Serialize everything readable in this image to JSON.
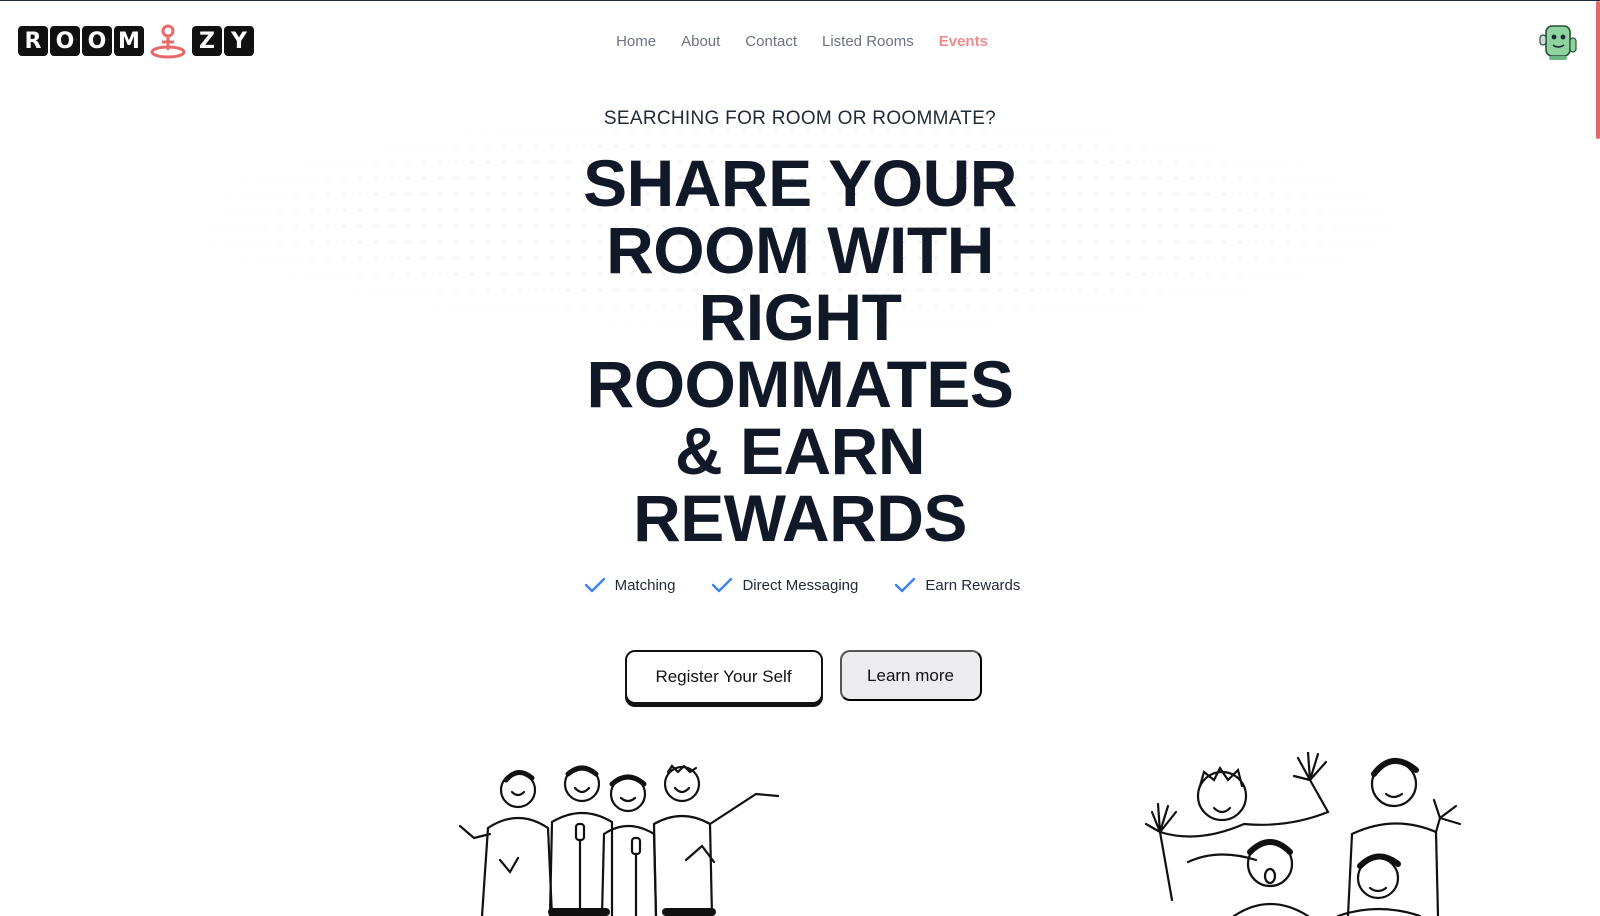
{
  "brand": {
    "letters_left": [
      "R",
      "O",
      "O",
      "M"
    ],
    "letters_right": [
      "Z",
      "Y"
    ],
    "pin_icon": "map-pin-icon",
    "accent": "#f08b8b"
  },
  "nav": {
    "items": [
      {
        "label": "Home"
      },
      {
        "label": "About"
      },
      {
        "label": "Contact"
      },
      {
        "label": "Listed Rooms"
      },
      {
        "label": "Events"
      }
    ],
    "active": "Events"
  },
  "hero": {
    "eyebrow": "SEARCHING FOR ROOM OR ROOMMATE?",
    "headline_lines": [
      "SHARE YOUR",
      "ROOM WITH",
      "RIGHT",
      "ROOMMATES",
      "& EARN",
      "REWARDS"
    ],
    "features": [
      {
        "label": "Matching",
        "icon": "check-icon"
      },
      {
        "label": "Direct Messaging",
        "icon": "check-icon"
      },
      {
        "label": "Earn Rewards",
        "icon": "check-icon"
      }
    ],
    "check_color": "#3b82f6",
    "primary_button": "Register Your Self",
    "secondary_button": "Learn more"
  },
  "user": {
    "avatar_icon": "robot-avatar-icon"
  }
}
